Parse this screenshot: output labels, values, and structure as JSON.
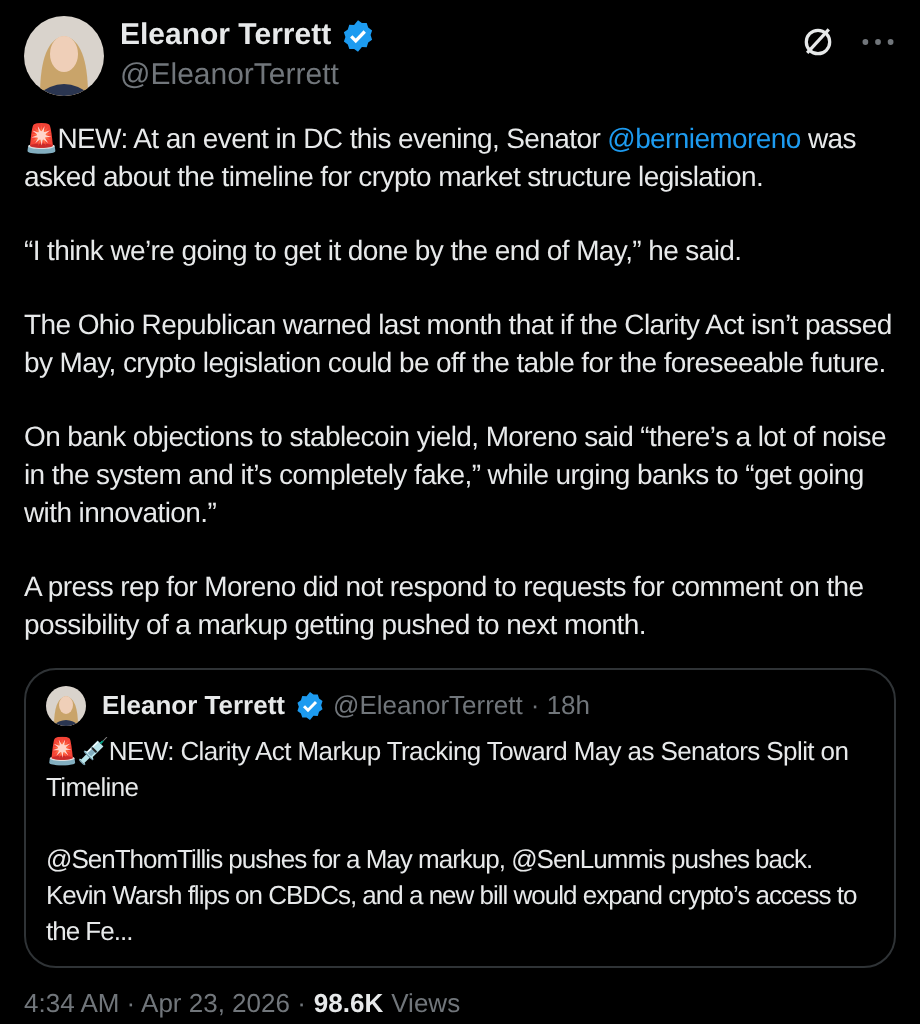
{
  "author": {
    "name": "Eleanor Terrett",
    "handle": "@EleanorTerrett",
    "verified": true
  },
  "paragraphs": [
    {
      "parts": [
        {
          "text": "🚨NEW: At an event in DC this evening, Senator ",
          "kind": "text"
        },
        {
          "text": "@berniemoreno",
          "kind": "mention"
        },
        {
          "text": " was asked about the timeline for crypto market structure legislation.",
          "kind": "text"
        }
      ]
    },
    {
      "parts": [
        {
          "text": "“I think we’re going to get it done by the end of May,” he said.",
          "kind": "text"
        }
      ]
    },
    {
      "parts": [
        {
          "text": "The Ohio Republican warned last month that if the Clarity Act isn’t passed by May, crypto legislation could be off the table for the foreseeable future.",
          "kind": "text"
        }
      ]
    },
    {
      "parts": [
        {
          "text": "On bank objections to stablecoin yield, Moreno said “there’s a lot of noise in the system and it’s completely fake,” while urging banks to “get going with innovation.”",
          "kind": "text"
        }
      ]
    },
    {
      "parts": [
        {
          "text": "A press rep for Moreno did not respond to requests for comment on the possibility of a markup getting pushed to next month.",
          "kind": "text"
        }
      ]
    }
  ],
  "quote": {
    "name": "Eleanor Terrett",
    "handle": "@EleanorTerrett",
    "age": "· 18h",
    "verified": true,
    "title": "🚨💉NEW: Clarity Act Markup Tracking Toward May as Senators Split on Timeline",
    "body": "@SenThomTillis pushes for a May markup, @SenLummis pushes back. Kevin Warsh flips on CBDCs, and a new bill would expand crypto’s access to the Fe..."
  },
  "footer": {
    "time": "4:34 AM · Apr 23, 2026 ·",
    "views_count": "98.6K",
    "views_label": "Views"
  }
}
